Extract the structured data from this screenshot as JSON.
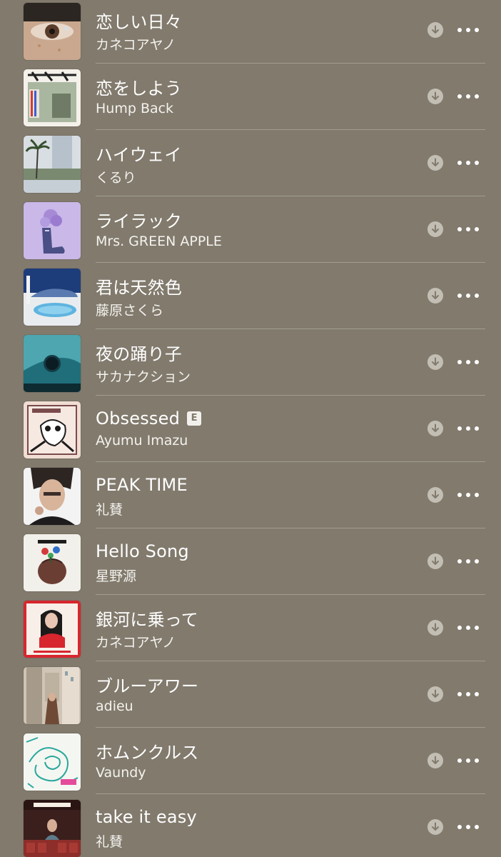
{
  "tracks": [
    {
      "title": "恋しい日々",
      "artist": "カネコアヤノ",
      "explicit": false,
      "artwork_icon": "album-art-eye-closeup"
    },
    {
      "title": "恋をしよう",
      "artist": "Hump Back",
      "explicit": false,
      "artwork_icon": "album-art-storefront"
    },
    {
      "title": "ハイウェイ",
      "artist": "くるり",
      "explicit": false,
      "artwork_icon": "album-art-palm-trees"
    },
    {
      "title": "ライラック",
      "artist": "Mrs. GREEN APPLE",
      "explicit": false,
      "artwork_icon": "album-art-lilac-shoe"
    },
    {
      "title": "君は天然色",
      "artist": "藤原さくら",
      "explicit": false,
      "artwork_icon": "album-art-pool"
    },
    {
      "title": "夜の踊り子",
      "artist": "サカナクション",
      "explicit": false,
      "artwork_icon": "album-art-teal-hole"
    },
    {
      "title": "Obsessed",
      "artist": "Ayumu Imazu",
      "explicit": true,
      "explicit_label": "E",
      "artwork_icon": "album-art-illustration"
    },
    {
      "title": "PEAK TIME",
      "artist": "礼賛",
      "explicit": false,
      "artwork_icon": "album-art-portrait"
    },
    {
      "title": "Hello Song",
      "artist": "星野源",
      "explicit": false,
      "artwork_icon": "album-art-pop-virus"
    },
    {
      "title": "銀河に乗って",
      "artist": "カネコアヤノ",
      "explicit": false,
      "artwork_icon": "album-art-red-frame"
    },
    {
      "title": "ブルーアワー",
      "artist": "adieu",
      "explicit": false,
      "artwork_icon": "album-art-buildings"
    },
    {
      "title": "ホムンクルス",
      "artist": "Vaundy",
      "explicit": false,
      "artwork_icon": "album-art-line-drawing"
    },
    {
      "title": "take it easy",
      "artist": "礼賛",
      "explicit": false,
      "artwork_icon": "album-art-theater"
    }
  ],
  "icons": {
    "download": "download-icon",
    "more": "more-options-icon"
  },
  "colors": {
    "background": "#817a6d",
    "separator": "#a39d91",
    "download_icon": "#c3beb3",
    "text": "#ffffff"
  }
}
